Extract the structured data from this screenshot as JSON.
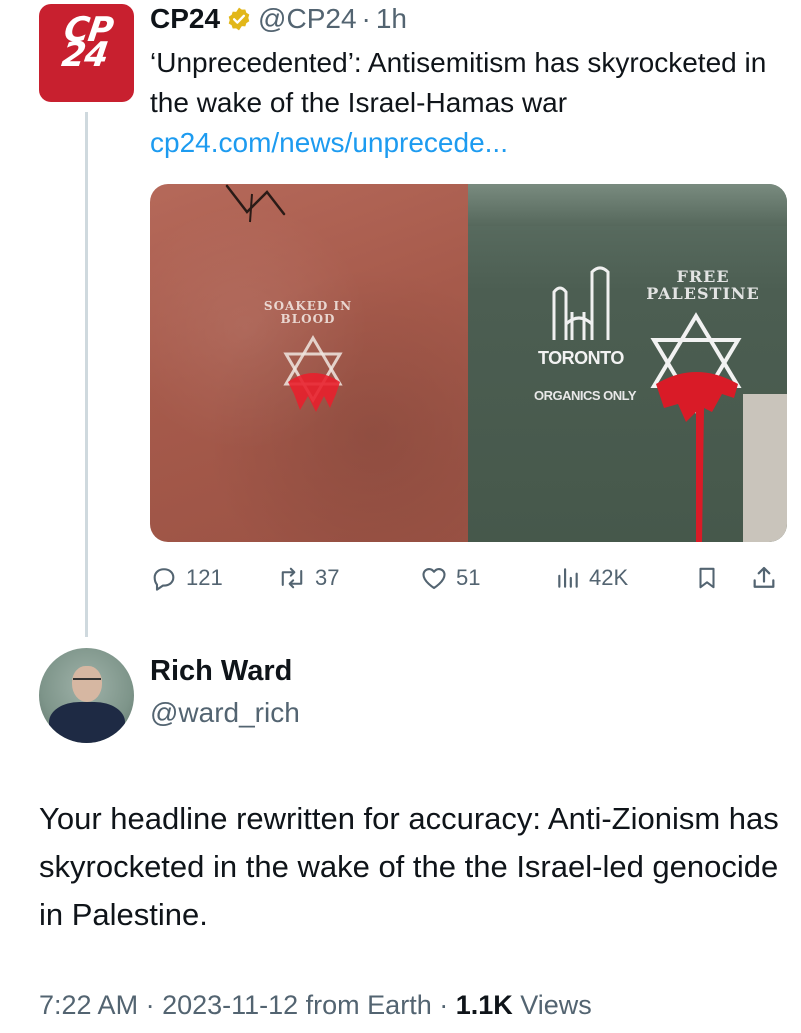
{
  "parent_tweet": {
    "logo_text_line1": "CP",
    "logo_text_line2": "24",
    "display_name": "CP24",
    "handle": "@CP24",
    "separator": "·",
    "time": "1h",
    "text": "‘Unprecedented’: Antisemitism has skyrocketed in the wake of the Israel-Hamas war",
    "link": "cp24.com/news/unprecede...",
    "media": {
      "left_stencil": "SOAKED IN BLOOD",
      "right_stencil": "FREE PALESTINE",
      "bin_brand": "TORONTO",
      "bin_label": "ORGANICS ONLY"
    },
    "actions": {
      "replies": "121",
      "reposts": "37",
      "likes": "51",
      "views": "42K"
    }
  },
  "main_tweet": {
    "display_name": "Rich Ward",
    "handle": "@ward_rich",
    "text": "Your headline rewritten for accuracy: Anti-Zionism has skyrocketed in the wake of the the Israel-led genocide in Palestine.",
    "meta": {
      "time": "7:22 AM",
      "separator1": " · ",
      "date": "2023-11-12",
      "source": " from Earth",
      "separator2": " · ",
      "views_count": "1.1K",
      "views_label": " Views"
    }
  },
  "colors": {
    "link": "#1d9bf0",
    "secondary_text": "#536471",
    "cp24_red": "#c8202f",
    "verified_gold": "#e2b719"
  }
}
